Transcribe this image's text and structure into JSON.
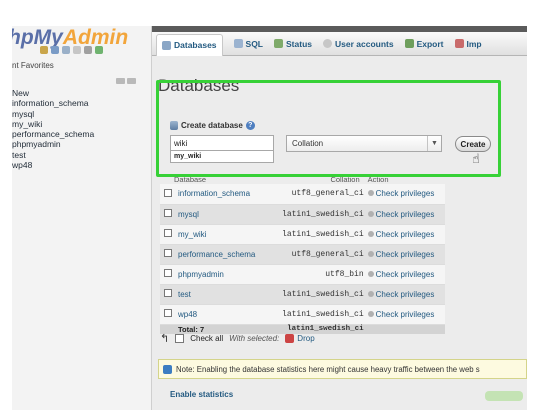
{
  "logo": {
    "part1": "hpMy",
    "part2": "Admin"
  },
  "nav": {
    "favorites_label": "nt  Favorites",
    "databases": [
      "New",
      "information_schema",
      "mysql",
      "my_wiki",
      "performance_schema",
      "phpmyadmin",
      "test",
      "wp48"
    ]
  },
  "tabs": [
    {
      "label": "Databases",
      "icon": "database-icon"
    },
    {
      "label": "SQL",
      "icon": "sql-icon"
    },
    {
      "label": "Status",
      "icon": "status-icon"
    },
    {
      "label": "User accounts",
      "icon": "users-icon"
    },
    {
      "label": "Export",
      "icon": "export-icon"
    },
    {
      "label": "Imp",
      "icon": "import-icon"
    }
  ],
  "page_title": "Databases",
  "create": {
    "label": "Create database",
    "name_value": "wiki",
    "autocomplete": "my_wiki",
    "collation_value": "Collation",
    "button": "Create"
  },
  "table": {
    "headers": [
      "Database",
      "Collation",
      "Action"
    ],
    "rows": [
      {
        "name": "information_schema",
        "collation": "utf8_general_ci",
        "action": "Check privileges"
      },
      {
        "name": "mysql",
        "collation": "latin1_swedish_ci",
        "action": "Check privileges"
      },
      {
        "name": "my_wiki",
        "collation": "latin1_swedish_ci",
        "action": "Check privileges"
      },
      {
        "name": "performance_schema",
        "collation": "utf8_general_ci",
        "action": "Check privileges"
      },
      {
        "name": "phpmyadmin",
        "collation": "utf8_bin",
        "action": "Check privileges"
      },
      {
        "name": "test",
        "collation": "latin1_swedish_ci",
        "action": "Check privileges"
      },
      {
        "name": "wp48",
        "collation": "latin1_swedish_ci",
        "action": "Check privileges"
      }
    ],
    "total_label": "Total: 7",
    "total_collation": "latin1_swedish_ci"
  },
  "bulk": {
    "check_all": "Check all",
    "with_selected": "With selected:",
    "drop": "Drop"
  },
  "notice": "Note: Enabling the database statistics here might cause heavy traffic between the web s",
  "enable_stats": "Enable statistics",
  "colors": {
    "highlight": "#37d137",
    "link": "#235a81",
    "logo_blue": "#5a6fa8",
    "logo_orange": "#f2a53b"
  }
}
